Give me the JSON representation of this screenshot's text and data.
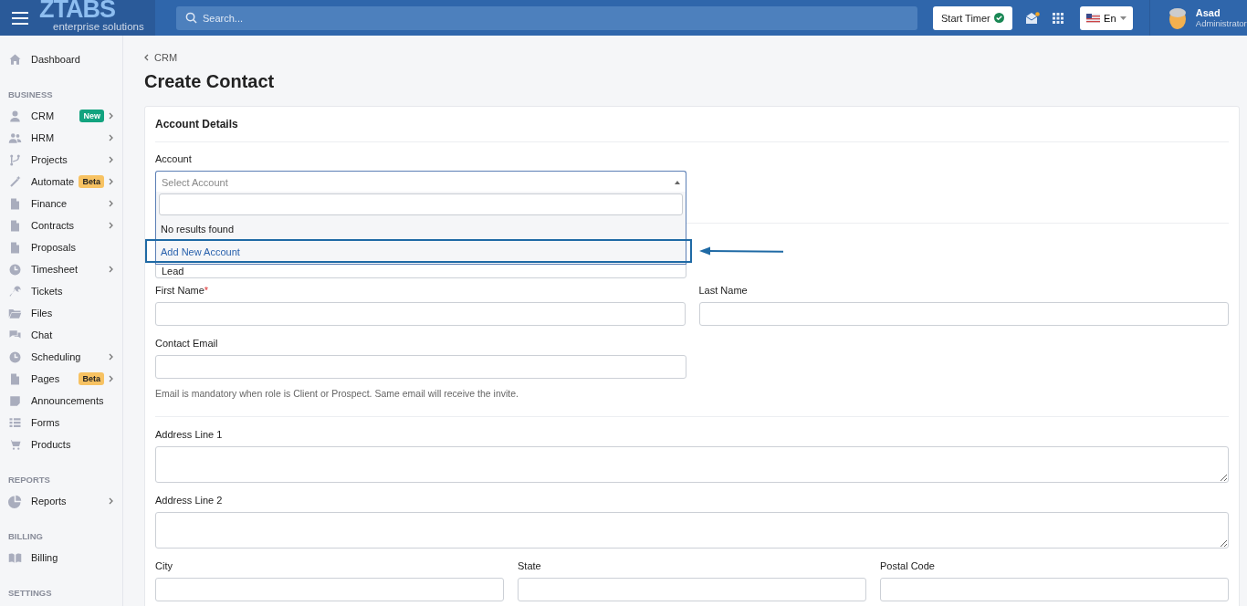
{
  "brand": {
    "logo": "ZTABS",
    "tagline": "enterprise solutions"
  },
  "topbar": {
    "search_placeholder": "Search...",
    "timer_button": "Start Timer",
    "notification_unread": true,
    "language": "En",
    "user": {
      "name": "Asad",
      "role": "Administrator"
    }
  },
  "sidebar": {
    "top": [
      {
        "label": "Dashboard",
        "arrow": false
      }
    ],
    "sections": [
      {
        "title": "BUSINESS",
        "items": [
          {
            "label": "CRM",
            "badge": "New",
            "color": "#12a37f",
            "arrow": true
          },
          {
            "label": "HRM",
            "arrow": true
          },
          {
            "label": "Projects",
            "arrow": true
          },
          {
            "label": "Automate",
            "badge": "Beta",
            "color": "#f7c262",
            "arrow": true
          },
          {
            "label": "Finance",
            "arrow": true
          },
          {
            "label": "Contracts",
            "arrow": true
          },
          {
            "label": "Proposals",
            "arrow": false
          },
          {
            "label": "Timesheet",
            "arrow": true
          },
          {
            "label": "Tickets",
            "arrow": false
          },
          {
            "label": "Files",
            "arrow": false
          },
          {
            "label": "Chat",
            "arrow": false
          },
          {
            "label": "Scheduling",
            "arrow": true
          },
          {
            "label": "Pages",
            "badge": "Beta",
            "color": "#f7c262",
            "arrow": true
          },
          {
            "label": "Announcements",
            "arrow": false
          },
          {
            "label": "Forms",
            "arrow": false
          },
          {
            "label": "Products",
            "arrow": false
          }
        ]
      },
      {
        "title": "REPORTS",
        "items": [
          {
            "label": "Reports",
            "arrow": true
          }
        ]
      },
      {
        "title": "BILLING",
        "items": [
          {
            "label": "Billing",
            "arrow": false
          }
        ]
      },
      {
        "title": "SETTINGS"
      }
    ]
  },
  "breadcrumb": "CRM",
  "page_title": "Create Contact",
  "card": {
    "title": "Account Details",
    "account": {
      "label": "Account",
      "placeholder": "Select Account",
      "no_results": "No results found",
      "add_option": "Add New Account",
      "expanded": true
    },
    "role_select": {
      "value": "Lead"
    },
    "first_name": {
      "label": "First Name",
      "required_mark": "*"
    },
    "last_name": {
      "label": "Last Name"
    },
    "contact_email": {
      "label": "Contact Email",
      "hint": "Email is mandatory when role is Client or Prospect. Same email will receive the invite."
    },
    "address1": {
      "label": "Address Line 1"
    },
    "address2": {
      "label": "Address Line 2"
    },
    "city": {
      "label": "City"
    },
    "state": {
      "label": "State"
    },
    "postal": {
      "label": "Postal Code"
    }
  }
}
